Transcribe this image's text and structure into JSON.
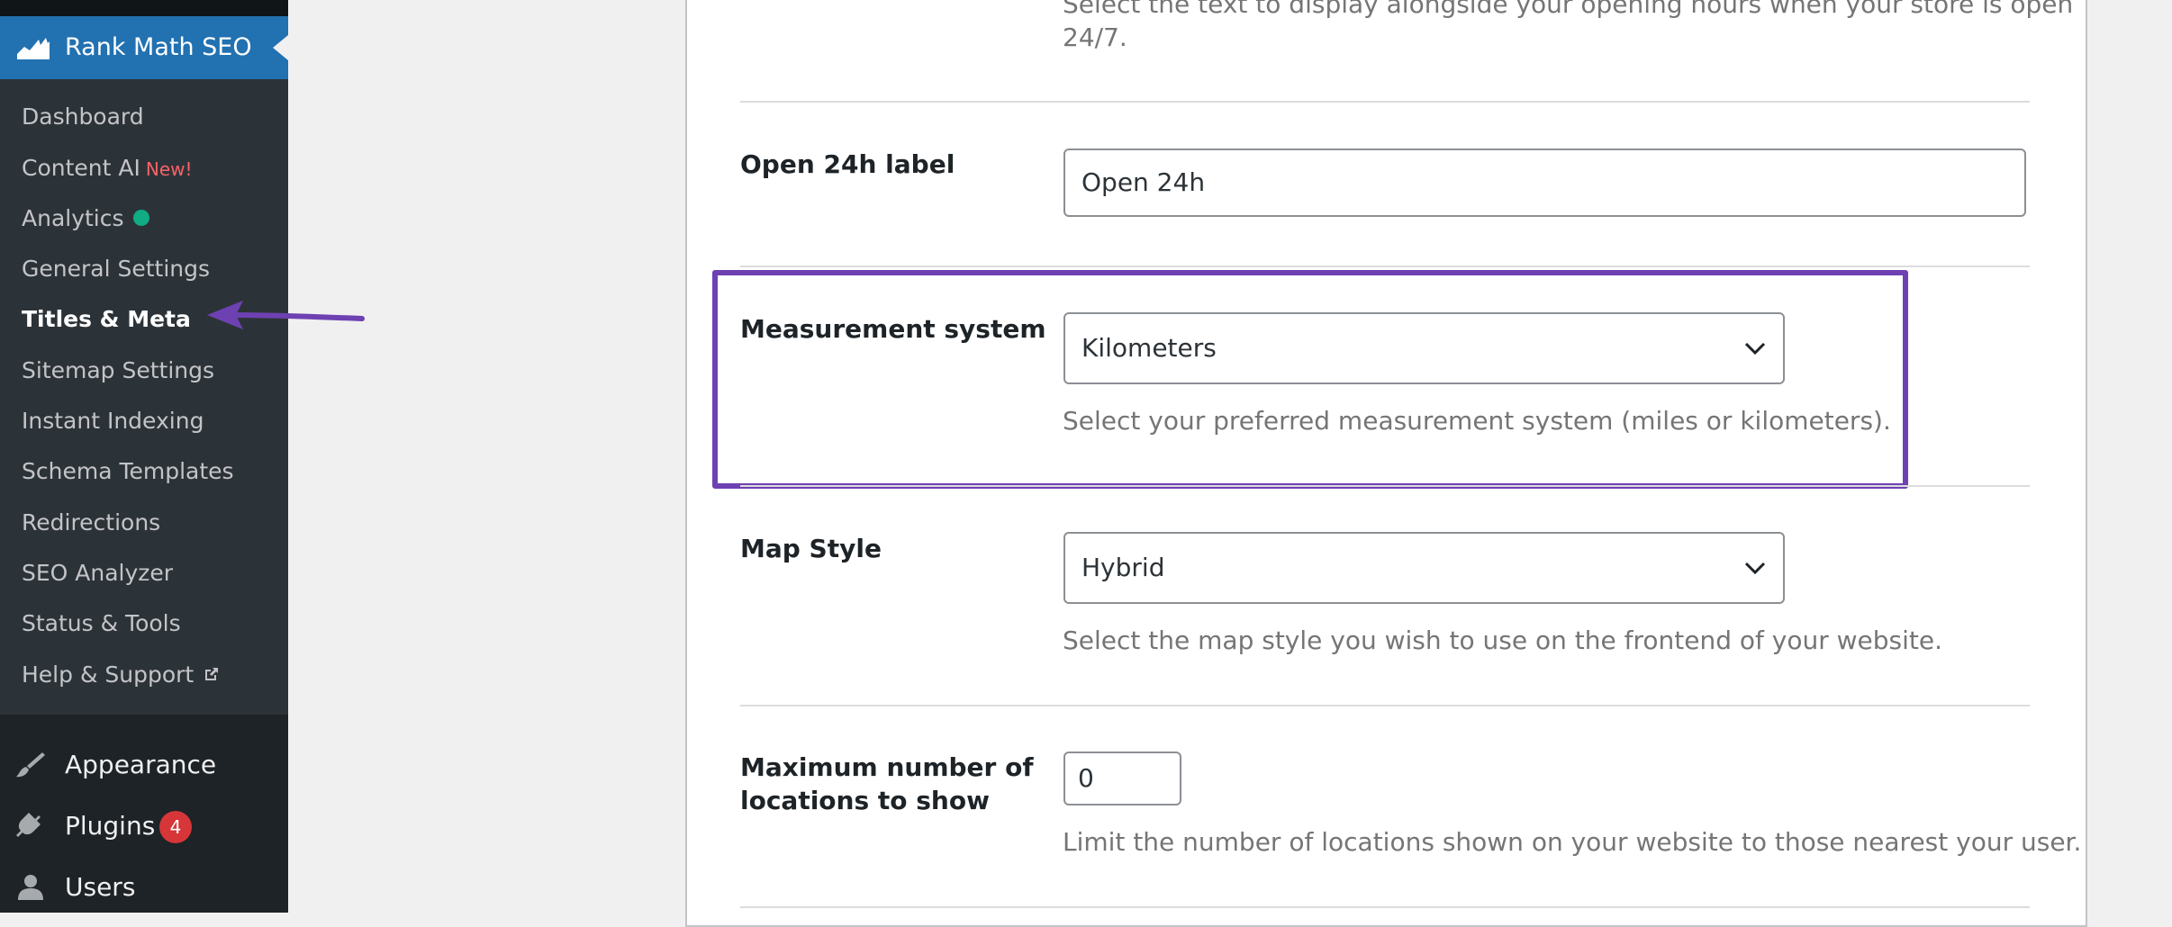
{
  "sidebar": {
    "plugin_title": "Rank Math SEO",
    "submenu": [
      {
        "label": "Dashboard"
      },
      {
        "label": "Content AI",
        "tag": "New!"
      },
      {
        "label": "Analytics"
      },
      {
        "label": "General Settings"
      },
      {
        "label": "Titles & Meta",
        "current": true
      },
      {
        "label": "Sitemap Settings"
      },
      {
        "label": "Instant Indexing"
      },
      {
        "label": "Schema Templates"
      },
      {
        "label": "Redirections"
      },
      {
        "label": "SEO Analyzer"
      },
      {
        "label": "Status & Tools"
      },
      {
        "label": "Help & Support"
      }
    ],
    "main": [
      {
        "label": "Appearance",
        "icon": "paintbrush-icon"
      },
      {
        "label": "Plugins",
        "icon": "plugin-icon",
        "badge": "4"
      },
      {
        "label": "Users",
        "icon": "user-icon"
      }
    ]
  },
  "colors": {
    "sidebar_bg": "#1d2327",
    "submenu_bg": "#2c3338",
    "wp_blue": "#2271b1",
    "highlight": "#6e41b2",
    "badge_red": "#d63638",
    "new_tag": "#f86368",
    "analytics_dot": "#10ac84"
  },
  "settings": {
    "open247_desc_line1": "Select the text to display alongside your opening hours when your store is open",
    "open247_desc_line2": "24/7.",
    "open24h": {
      "label": "Open 24h label",
      "value": "Open 24h"
    },
    "measurement": {
      "label": "Measurement system",
      "selected": "Kilometers",
      "desc": "Select your preferred measurement system (miles or kilometers)."
    },
    "map_style": {
      "label": "Map Style",
      "selected": "Hybrid",
      "desc": "Select the map style you wish to use on the frontend of your website."
    },
    "max_locations": {
      "label_line1": "Maximum number of",
      "label_line2": "locations to show",
      "value": "0",
      "desc": "Limit the number of locations shown on your website to those nearest your user."
    }
  }
}
